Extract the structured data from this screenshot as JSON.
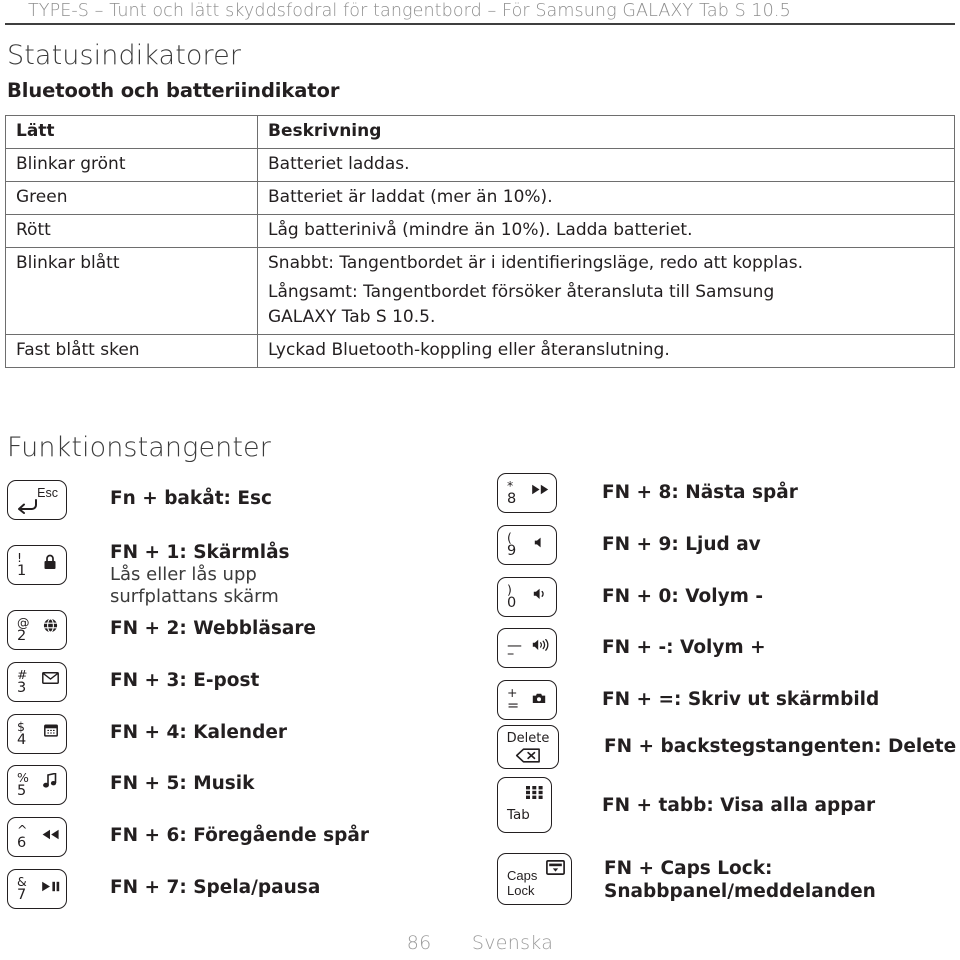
{
  "header": {
    "running_title": "TYPE-S – Tunt och lätt skyddsfodral för tangentbord – För Samsung GALAXY Tab S 10.5"
  },
  "section_status": {
    "heading": "Statusindikatorer",
    "subheading": "Bluetooth och batteriindikator",
    "table": {
      "columns": [
        "Lätt",
        "Beskrivning"
      ],
      "rows": [
        {
          "light": "Blinkar grönt",
          "description": "Batteriet laddas."
        },
        {
          "light": "Green",
          "description": "Batteriet är laddat (mer än 10%)."
        },
        {
          "light": "Rött",
          "description": "Låg batterinivå (mindre än 10%). Ladda batteriet."
        },
        {
          "light": "Blinkar blått",
          "description_line1": "Snabbt: Tangentbordet är i identifieringsläge, redo att kopplas.",
          "description_line2": "Långsamt: Tangentbordet försöker återansluta till Samsung",
          "description_line3": "GALAXY Tab S 10.5."
        },
        {
          "light": "Fast blått sken",
          "description": "Lyckad Bluetooth-koppling eller återanslutning."
        }
      ]
    }
  },
  "section_function_keys": {
    "heading": "Funktionstangenter",
    "left_items": [
      {
        "key": {
          "type": "esc",
          "top_right_word": "Esc",
          "icon": "back-arrow-icon"
        },
        "title": "Fn + bakåt: Esc",
        "subtitle": ""
      },
      {
        "key": {
          "type": "numeric",
          "top_left": "!",
          "bottom_left": "1",
          "icon": "lock-icon"
        },
        "title": "FN + 1: Skärmlås",
        "subtitle_line1": "Lås eller lås upp",
        "subtitle_line2": "surfplattans skärm"
      },
      {
        "key": {
          "type": "numeric",
          "top_left": "@",
          "bottom_left": "2",
          "icon": "globe-browser-icon"
        },
        "title": "FN + 2: Webbläsare",
        "subtitle": ""
      },
      {
        "key": {
          "type": "numeric",
          "top_left": "#",
          "bottom_left": "3",
          "icon": "envelope-mail-icon"
        },
        "title": "FN + 3: E-post",
        "subtitle": ""
      },
      {
        "key": {
          "type": "numeric",
          "top_left": "$",
          "bottom_left": "4",
          "icon": "calendar-icon"
        },
        "title": "FN + 4: Kalender",
        "subtitle": ""
      },
      {
        "key": {
          "type": "numeric",
          "top_left": "%",
          "bottom_left": "5",
          "icon": "music-note-icon"
        },
        "title": "FN + 5: Musik",
        "subtitle": ""
      },
      {
        "key": {
          "type": "numeric",
          "top_left": "^",
          "bottom_left": "6",
          "icon": "rewind-previous-icon"
        },
        "title": "FN + 6: Föregående spår",
        "subtitle": ""
      },
      {
        "key": {
          "type": "numeric",
          "top_left": "&",
          "bottom_left": "7",
          "icon": "play-pause-icon"
        },
        "title": "FN + 7: Spela/pausa",
        "subtitle": ""
      }
    ],
    "right_items": [
      {
        "key": {
          "type": "numeric",
          "top_left": "*",
          "bottom_left": "8",
          "icon": "fast-forward-next-icon"
        },
        "title": "FN + 8: Nästa spår"
      },
      {
        "key": {
          "type": "numeric",
          "top_left": "(",
          "bottom_left": "9",
          "icon": "mute-icon"
        },
        "title": "FN + 9: Ljud av"
      },
      {
        "key": {
          "type": "numeric",
          "top_left": ")",
          "bottom_left": "0",
          "icon": "volume-down-icon"
        },
        "title": "FN + 0: Volym -"
      },
      {
        "key": {
          "type": "numeric",
          "top_left": "—",
          "bottom_left": "–",
          "icon": "volume-up-icon"
        },
        "title": "FN + -: Volym +"
      },
      {
        "key": {
          "type": "numeric",
          "top_left": "+",
          "bottom_left": "=",
          "icon": "screenshot-camera-icon"
        },
        "title": "FN + =: Skriv ut skärmbild"
      },
      {
        "key": {
          "type": "delete",
          "word": "Delete",
          "icon": "backspace-icon"
        },
        "title": "FN + backstegstangenten: Delete"
      },
      {
        "key": {
          "type": "tab",
          "word": "Tab",
          "icon": "apps-grid-icon"
        },
        "title": "FN + tabb: Visa alla appar"
      },
      {
        "key": {
          "type": "caps",
          "word_line1": "Caps",
          "word_line2": "Lock",
          "icon": "notification-panel-icon"
        },
        "title_line1": "FN + Caps Lock:",
        "title_line2": "Snabbpanel/meddelanden"
      }
    ]
  },
  "footer": {
    "page_number": "86",
    "language": "Svenska"
  },
  "colors": {
    "text": "#231f20",
    "muted": "#8d8d8d",
    "rule": "#3f3f3f",
    "table_border": "#6e6e6e"
  }
}
